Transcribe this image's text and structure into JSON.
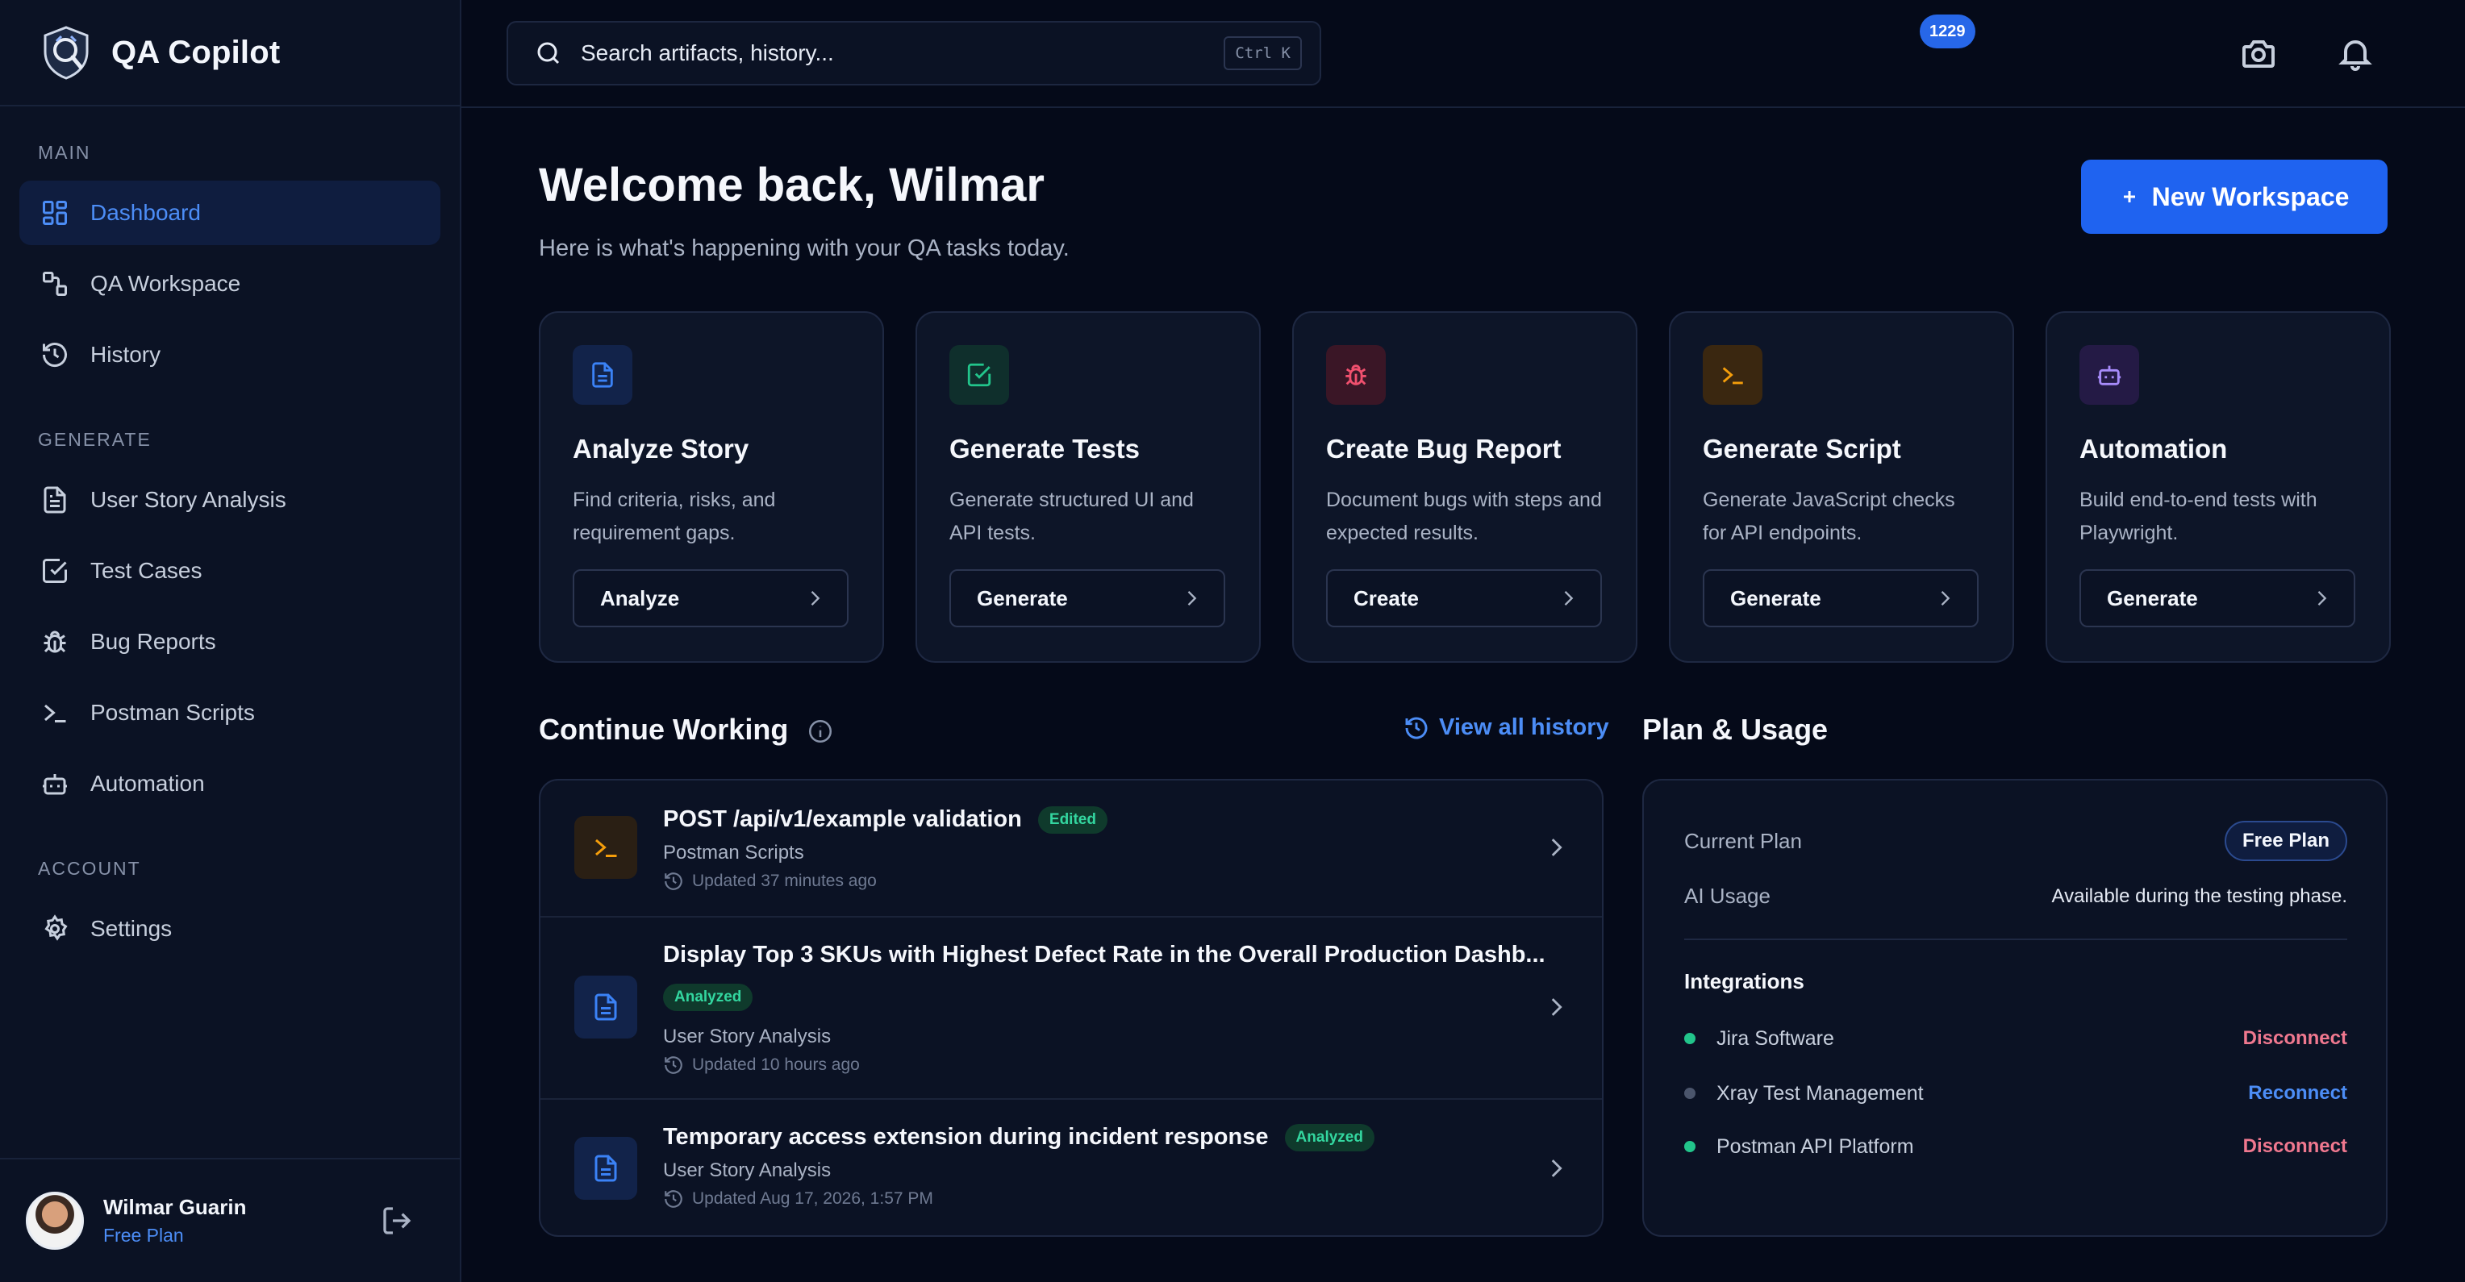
{
  "app": {
    "title": "QA Copilot"
  },
  "sidebar": {
    "sections": [
      {
        "label": "MAIN"
      },
      {
        "label": "GENERATE"
      },
      {
        "label": "ACCOUNT"
      }
    ],
    "items": [
      {
        "label": "Dashboard",
        "icon": "dashboard-grid-icon",
        "active": true
      },
      {
        "label": "QA Workspace",
        "icon": "workspace-nodes-icon"
      },
      {
        "label": "History",
        "icon": "history-icon"
      },
      {
        "label": "User Story Analysis",
        "icon": "document-icon"
      },
      {
        "label": "Test Cases",
        "icon": "checkbox-icon"
      },
      {
        "label": "Bug Reports",
        "icon": "bug-icon"
      },
      {
        "label": "Postman Scripts",
        "icon": "terminal-icon"
      },
      {
        "label": "Automation",
        "icon": "robot-icon"
      },
      {
        "label": "Settings",
        "icon": "gear-icon"
      }
    ],
    "user": {
      "name": "Wilmar Guarin",
      "plan": "Free Plan"
    }
  },
  "topbar": {
    "search_placeholder": "Search artifacts, history...",
    "shortcut": "Ctrl K",
    "notification_count": "1229"
  },
  "main": {
    "welcome": "Welcome back, Wilmar",
    "subtitle": "Here is what's happening with your QA tasks today.",
    "new_workspace": "New Workspace",
    "cards": [
      {
        "title": "Analyze Story",
        "desc": "Find criteria, risks, and requirement gaps.",
        "button": "Analyze",
        "icon": "document-icon",
        "color": "#3b82f6"
      },
      {
        "title": "Generate Tests",
        "desc": "Generate structured UI and API tests.",
        "button": "Generate",
        "icon": "checkbox-icon",
        "color": "#22c58b"
      },
      {
        "title": "Create Bug Report",
        "desc": "Document bugs with steps and expected results.",
        "button": "Create",
        "icon": "bug-icon",
        "color": "#f0506e"
      },
      {
        "title": "Generate Script",
        "desc": "Generate JavaScript checks for API endpoints.",
        "button": "Generate",
        "icon": "terminal-icon",
        "color": "#f59e0b"
      },
      {
        "title": "Automation",
        "desc": "Build end-to-end tests with Playwright.",
        "button": "Generate",
        "icon": "robot-icon",
        "color": "#a78bfa"
      }
    ],
    "continue_working": {
      "title": "Continue Working",
      "view_all": "View all history",
      "items": [
        {
          "title": "POST /api/v1/example validation",
          "badge": "Edited",
          "type": "Postman Scripts",
          "updated": "Updated 37 minutes ago",
          "icon": "terminal-icon"
        },
        {
          "title": "Display Top 3 SKUs with Highest Defect Rate in the Overall Production Dashb...",
          "badge": "Analyzed",
          "type": "User Story Analysis",
          "updated": "Updated 10 hours ago",
          "icon": "document-icon"
        },
        {
          "title": "Temporary access extension during incident response",
          "badge": "Analyzed",
          "type": "User Story Analysis",
          "updated": "Updated Aug 17, 2026, 1:57 PM",
          "icon": "document-icon"
        }
      ]
    },
    "plan_usage": {
      "title": "Plan & Usage",
      "current_plan_label": "Current Plan",
      "current_plan_value": "Free Plan",
      "ai_usage_label": "AI Usage",
      "ai_usage_value": "Available during the testing phase.",
      "integrations_title": "Integrations",
      "integrations": [
        {
          "name": "Jira Software",
          "action": "Disconnect",
          "connected": true
        },
        {
          "name": "Xray Test Management",
          "action": "Reconnect",
          "connected": false
        },
        {
          "name": "Postman API Platform",
          "action": "Disconnect",
          "connected": true
        }
      ]
    }
  },
  "colors": {
    "accent": "#1f63f0",
    "link": "#4c8df6",
    "success": "#22c58b",
    "danger": "#f0788f",
    "background": "#050a19"
  }
}
